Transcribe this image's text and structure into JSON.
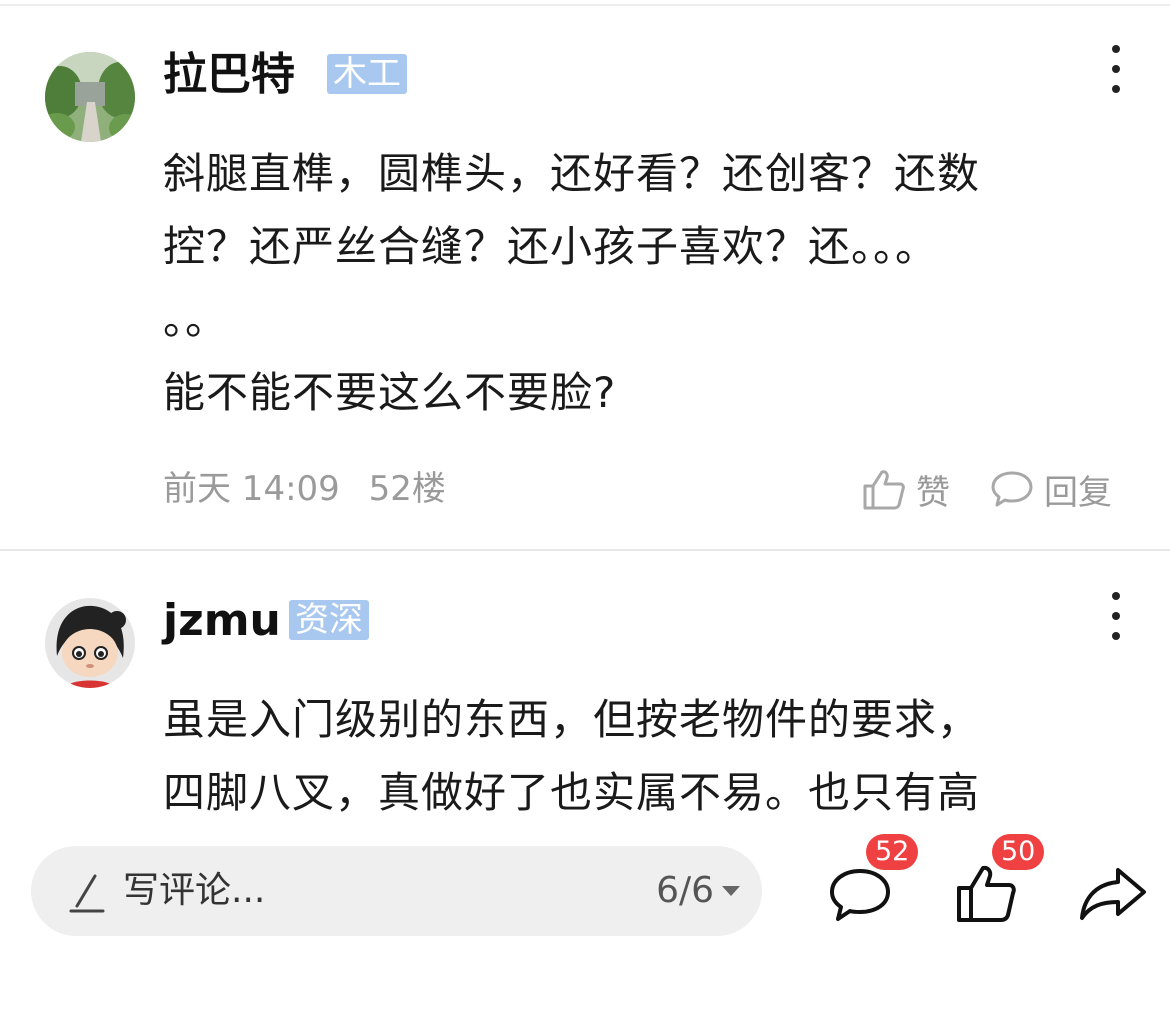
{
  "comments": [
    {
      "username": "拉巴特",
      "badge": "木工",
      "lines": [
        "斜腿直榫，圆榫头，还好看？还创客？还数",
        "控？还严丝合缝？还小孩子喜欢？还。。。",
        "。。",
        "能不能不要这么不要脸?"
      ],
      "time": "前天 14:09",
      "floor": "52楼",
      "like_label": "赞",
      "reply_label": "回复"
    },
    {
      "username": "jzmu",
      "badge": "资深",
      "lines": [
        "虽是入门级别的东西，但按老物件的要求，",
        "四脚八叉，真做好了也实属不易。也只有高"
      ]
    }
  ],
  "bottom_bar": {
    "placeholder": "写评论...",
    "pager": "6/6",
    "comment_count": "52",
    "like_count": "50"
  },
  "colors": {
    "badge_bg": "#a9c8f0",
    "count_badge": "#f04142",
    "meta_text": "#9a9a9a"
  },
  "icons": [
    "more-icon",
    "thumb-up-icon",
    "chat-bubble-icon",
    "pen-icon",
    "share-icon"
  ]
}
